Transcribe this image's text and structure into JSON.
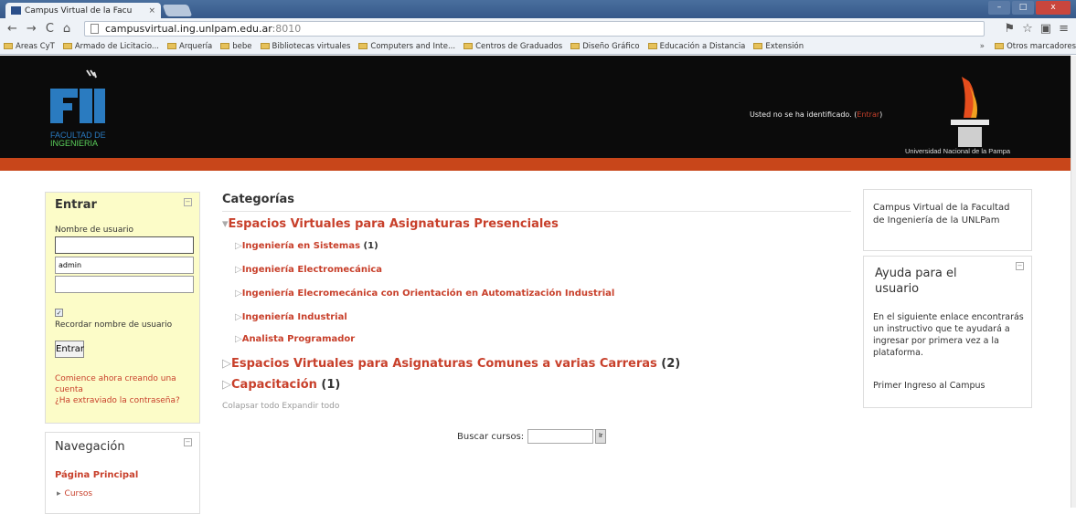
{
  "browser": {
    "tab_title": "Campus Virtual de la Facu",
    "tab_close": "×",
    "url_host": "campusvirtual.ing.unlpam.edu.ar",
    "url_port": ":8010",
    "win_min": "–",
    "win_max": "□",
    "win_close": "x",
    "bookmarks": [
      "Areas CyT",
      "Armado de Licitacio...",
      "Arquería",
      "bebe",
      "Bibliotecas virtuales",
      "Computers and Inte...",
      "Centros de Graduados",
      "Diseño Gráfico",
      "Educación a Distancia",
      "Extensión"
    ],
    "bookmarks_more": "»",
    "bookmarks_other": "Otros marcadores"
  },
  "header": {
    "logo_line1": "FACULTAD DE",
    "logo_line2": "INGENIERIA",
    "login_status_prefix": "Usted no se ha identificado. (",
    "login_status_link": "Entrar",
    "login_status_suffix": ")",
    "university": "Universidad Nacional de la Pampa",
    "colors": {
      "band": "#c8461a",
      "header_bg": "#0b0b0b",
      "logo_blue": "#2a7bc0"
    }
  },
  "login": {
    "title": "Entrar",
    "username_label": "Nombre de usuario",
    "username_value": "",
    "password_value": "admin",
    "remember_label": "Recordar nombre de usuario",
    "remember_checked": "✓",
    "submit": "Entrar",
    "create_account": "Comience ahora creando una cuenta",
    "forgot_password": "¿Ha extraviado la contraseña?"
  },
  "navigation": {
    "title": "Navegación",
    "home": "Página Principal",
    "courses": "Cursos"
  },
  "categories": {
    "title": "Categorías",
    "items": [
      {
        "label": "Espacios Virtuales para Asignaturas Presenciales",
        "marker": "▾",
        "count": ""
      },
      {
        "label": "Ingeniería en Sistemas",
        "marker": "▷",
        "count": "(1)"
      },
      {
        "label": "Ingeniería Electromecánica",
        "marker": "▷",
        "count": ""
      },
      {
        "label": "Ingeniería Elecromecánica con Orientación en Automatización Industrial",
        "marker": "▷",
        "count": ""
      },
      {
        "label": "Ingeniería Industrial",
        "marker": "▷",
        "count": ""
      },
      {
        "label": "Analista Programador",
        "marker": "▷",
        "count": ""
      },
      {
        "label": "Espacios Virtuales para Asignaturas Comunes a varias Carreras",
        "marker": "▷",
        "count": "(2)"
      },
      {
        "label": "Capacitación",
        "marker": "▷",
        "count": "(1)"
      }
    ],
    "collapse_all": "Colapsar todo",
    "expand_all": "Expandir todo"
  },
  "search": {
    "label": "Buscar cursos:",
    "button": "Ir"
  },
  "info": {
    "text": "Campus Virtual de la Facultad de Ingeniería de la UNLPam"
  },
  "help": {
    "title": "Ayuda para el usuario",
    "text": "En el siguiente enlace encontrarás un instructivo que te ayudará a ingresar por primera vez a la plataforma.",
    "link": "Primer Ingreso al Campus"
  }
}
